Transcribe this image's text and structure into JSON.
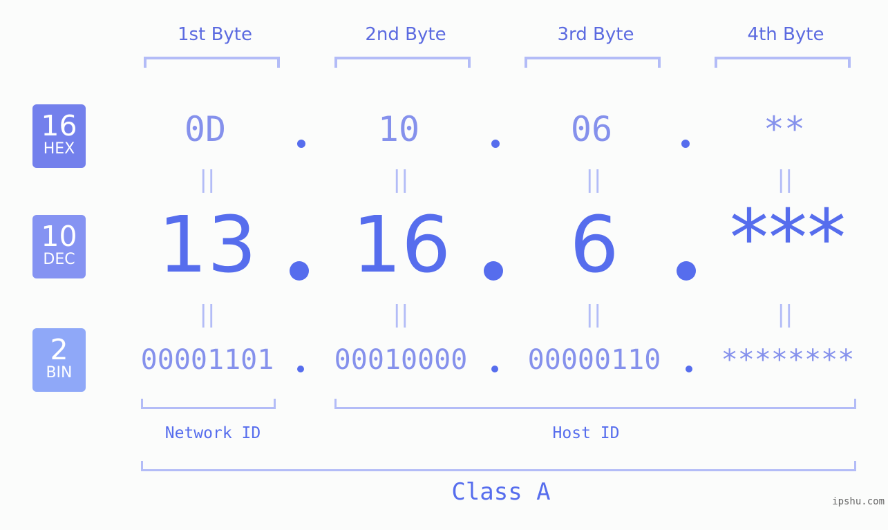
{
  "header": {
    "bytes": [
      "1st Byte",
      "2nd Byte",
      "3rd Byte",
      "4th Byte"
    ]
  },
  "badges": [
    {
      "number": "16",
      "label": "HEX",
      "color": "#7380ec"
    },
    {
      "number": "10",
      "label": "DEC",
      "color": "#8593f2"
    },
    {
      "number": "2",
      "label": "BIN",
      "color": "#8fa8f8"
    }
  ],
  "rows": {
    "hex": [
      "0D",
      "10",
      "06",
      "**"
    ],
    "dec": [
      "13",
      "16",
      "6",
      "***"
    ],
    "bin": [
      "00001101",
      "00010000",
      "00000110",
      "********"
    ]
  },
  "equals_glyph": "||",
  "labels": {
    "network_id": "Network ID",
    "host_id": "Host ID",
    "class": "Class A"
  },
  "watermark": "ipshu.com",
  "colors": {
    "accent": "#566ded",
    "muted": "#8591ec",
    "bracket": "#b3bcf7",
    "background": "#fbfcfb"
  }
}
